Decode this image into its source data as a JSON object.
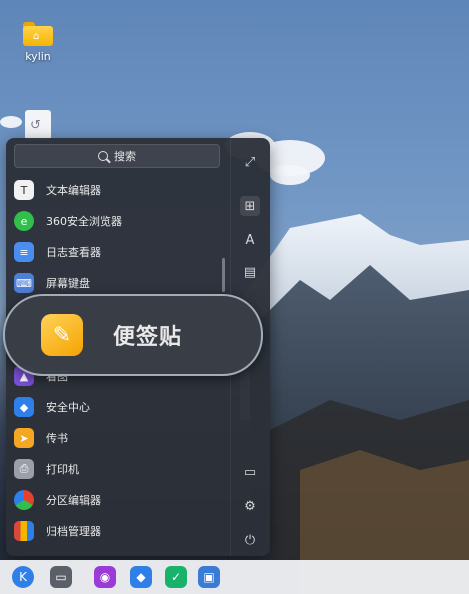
{
  "desktop": {
    "icons": [
      {
        "label": "kylin",
        "icon": "folder-icon"
      },
      {
        "label": "",
        "icon": "backup-restore-icon"
      }
    ]
  },
  "start_menu": {
    "search": {
      "placeholder": "搜索",
      "icon": "search-icon"
    },
    "apps": [
      {
        "label": "文本编辑器",
        "icon": "text-editor-icon",
        "color": "#f1f1f1"
      },
      {
        "label": "360安全浏览器",
        "icon": "browser-icon",
        "color": "#2fbf4a"
      },
      {
        "label": "日志查看器",
        "icon": "log-viewer-icon",
        "color": "#4a8df0"
      },
      {
        "label": "屏幕键盘",
        "icon": "keyboard-icon",
        "color": "#4d7fd6"
      },
      {
        "label": "便签贴",
        "icon": "note-icon",
        "color": "#f5b400"
      },
      {
        "label": "看图",
        "icon": "image-viewer-icon",
        "color": "#7a4fd6"
      },
      {
        "label": "安全中心",
        "icon": "security-center-icon",
        "color": "#2f7fe8"
      },
      {
        "label": "传书",
        "icon": "file-transfer-icon",
        "color": "#f5a623"
      },
      {
        "label": "打印机",
        "icon": "printer-icon",
        "color": "#9aa0a8"
      },
      {
        "label": "分区编辑器",
        "icon": "partition-editor-icon",
        "color": "#e6402f"
      },
      {
        "label": "归档管理器",
        "icon": "archive-manager-icon",
        "color": "#d9483b"
      }
    ],
    "side_buttons": [
      {
        "name": "expand",
        "glyph": "⤢"
      },
      {
        "name": "all-apps",
        "glyph": "⊞"
      },
      {
        "name": "letter-sort",
        "glyph": "A"
      },
      {
        "name": "category",
        "glyph": "▤"
      },
      {
        "name": "computer",
        "glyph": "▭"
      },
      {
        "name": "settings",
        "glyph": "⚙"
      },
      {
        "name": "power",
        "glyph": "⏻"
      }
    ]
  },
  "zoom_tooltip": {
    "label": "便签贴",
    "icon": "note-icon"
  },
  "taskbar": {
    "items": [
      {
        "name": "start-menu",
        "color": "#2f7fe8",
        "glyph": "K"
      },
      {
        "name": "multitask-view",
        "color": "#5a5f68",
        "glyph": "▭"
      },
      {
        "name": "camera",
        "color": "#9b3ad6",
        "glyph": "◉"
      },
      {
        "name": "security-center",
        "color": "#2f7fe8",
        "glyph": "◆"
      },
      {
        "name": "software-store",
        "color": "#19b26b",
        "glyph": "✓"
      },
      {
        "name": "image-viewer",
        "color": "#3a7bd5",
        "glyph": "▣"
      }
    ]
  }
}
